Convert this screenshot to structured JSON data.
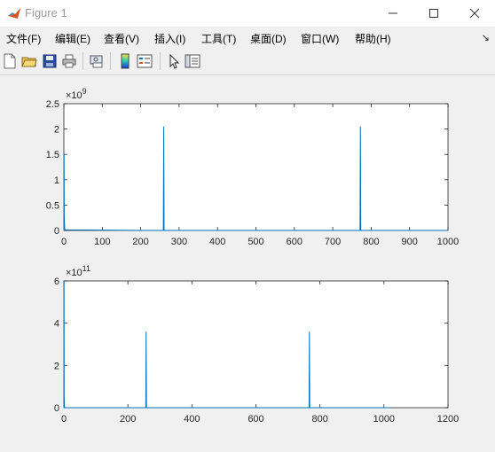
{
  "window": {
    "title": "Figure 1"
  },
  "menu": {
    "items": [
      "文件(F)",
      "编辑(E)",
      "查看(V)",
      "插入(I)",
      "工具(T)",
      "桌面(D)",
      "窗口(W)",
      "帮助(H)"
    ],
    "overflow_icon": "dock-arrow-icon"
  },
  "toolbar": {
    "buttons": [
      "new-figure-icon",
      "open-file-icon",
      "save-icon",
      "print-icon",
      "print-preview-icon",
      "colorbar-icon",
      "legend-icon",
      "pointer-icon",
      "property-editor-icon"
    ]
  },
  "colors": {
    "line": "#0072bd",
    "axes_bg": "#ffffff",
    "figure_bg": "#f0f0f0"
  },
  "chart_data": [
    {
      "type": "line",
      "title": "",
      "xlabel": "",
      "ylabel": "",
      "xlim": [
        0,
        1000
      ],
      "ylim": [
        0,
        2.5
      ],
      "exponent_label": "×10",
      "exponent_power": "9",
      "xticks": [
        "0",
        "100",
        "200",
        "300",
        "400",
        "500",
        "600",
        "700",
        "800",
        "900",
        "1000"
      ],
      "yticks": [
        "0",
        "0.5",
        "1",
        "1.5",
        "2",
        "2.5"
      ],
      "series": [
        {
          "x": [
            0,
            0.5,
            1,
            2,
            3,
            200,
            259,
            260,
            261,
            400,
            600,
            771,
            772,
            773,
            900,
            1000
          ],
          "y": [
            0,
            1.5,
            0.3,
            0.05,
            0.01,
            0,
            0,
            2.05,
            0,
            0,
            0,
            0,
            2.05,
            0,
            0,
            0
          ]
        }
      ]
    },
    {
      "type": "line",
      "title": "",
      "xlabel": "",
      "ylabel": "",
      "xlim": [
        0,
        1200
      ],
      "ylim": [
        0,
        6
      ],
      "exponent_label": "×10",
      "exponent_power": "11",
      "xticks": [
        "0",
        "200",
        "400",
        "600",
        "800",
        "1000",
        "1200"
      ],
      "yticks": [
        "0",
        "2",
        "4",
        "6"
      ],
      "series": [
        {
          "x": [
            0,
            0.5,
            1,
            2,
            200,
            256,
            257,
            258,
            500,
            766,
            767,
            768,
            900,
            1023
          ],
          "y": [
            0,
            6,
            0.5,
            0,
            0,
            0,
            3.6,
            0,
            0,
            0,
            3.6,
            0,
            0,
            0
          ]
        }
      ]
    }
  ]
}
